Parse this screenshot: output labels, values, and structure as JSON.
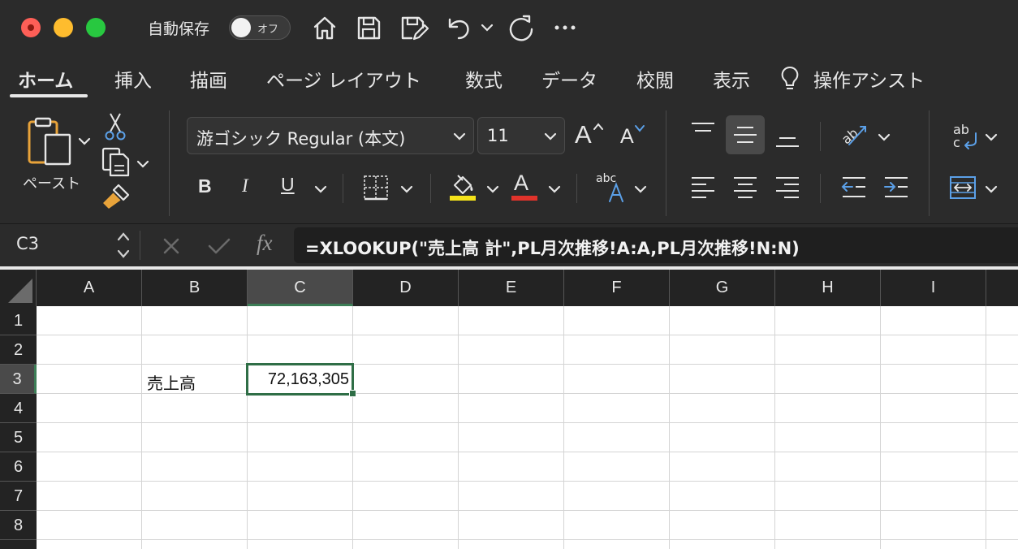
{
  "titlebar": {
    "autosave_label": "自動保存",
    "autosave_state": "オフ"
  },
  "tabs": [
    {
      "label": "ホーム",
      "active": true
    },
    {
      "label": "挿入"
    },
    {
      "label": "描画"
    },
    {
      "label": "ページ レイアウト"
    },
    {
      "label": "数式"
    },
    {
      "label": "データ"
    },
    {
      "label": "校閲"
    },
    {
      "label": "表示"
    },
    {
      "label": "操作アシスト"
    }
  ],
  "ribbon": {
    "paste_label": "ペースト",
    "font_name": "游ゴシック Regular (本文)",
    "font_size": "11",
    "bold": "B",
    "italic": "I",
    "underline": "U",
    "font_color_letter": "A",
    "abc": "abc",
    "abc_stack": "ab",
    "abc_stack2": "c",
    "grow_letter": "A",
    "shrink_letter": "A",
    "highlight_color": "#f5e31a",
    "font_color": "#e0332b"
  },
  "formula_bar": {
    "name_box": "C3",
    "formula": "=XLOOKUP(\"売上高 計\",PL月次推移!A:A,PL月次推移!N:N)",
    "fx_label": "fx"
  },
  "sheet": {
    "columns": [
      "A",
      "B",
      "C",
      "D",
      "E",
      "F",
      "G",
      "H",
      "I"
    ],
    "rows": [
      "1",
      "2",
      "3",
      "4",
      "5",
      "6",
      "7",
      "8"
    ],
    "selected_column": "C",
    "selected_row": "3",
    "cells": {
      "B3": "売上高",
      "C3": "72,163,305"
    }
  }
}
